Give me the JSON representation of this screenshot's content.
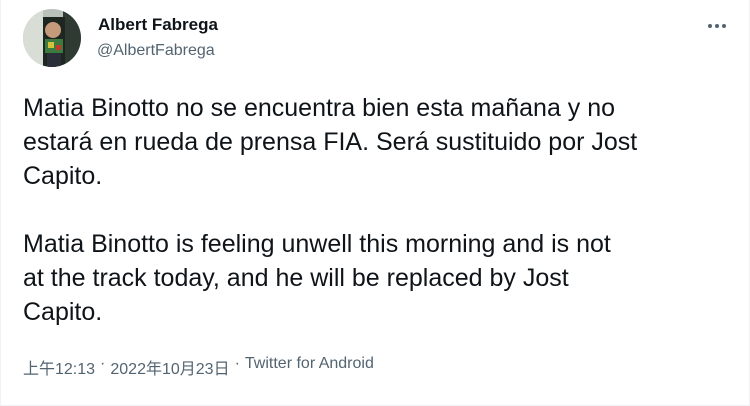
{
  "author": {
    "name": "Albert Fabrega",
    "handle": "@AlbertFabrega",
    "avatar_icon": "profile-photo-avatar"
  },
  "menu": {
    "icon": "more-horizontal-icon"
  },
  "tweet": {
    "text_es": "Matia Binotto no se encuentra bien esta mañana y no\nestará en rueda de prensa FIA. Será sustituido por Jost\nCapito.",
    "text_en": "Matia Binotto is feeling unwell this morning and is not\nat the track today, and he will be replaced by Jost\nCapito."
  },
  "meta": {
    "time": "上午12:13",
    "separator": "·",
    "date": "2022年10月23日",
    "source": "Twitter for Android"
  },
  "colors": {
    "text_primary": "#0f1419",
    "text_secondary": "#536471",
    "border": "#eff3f4"
  }
}
